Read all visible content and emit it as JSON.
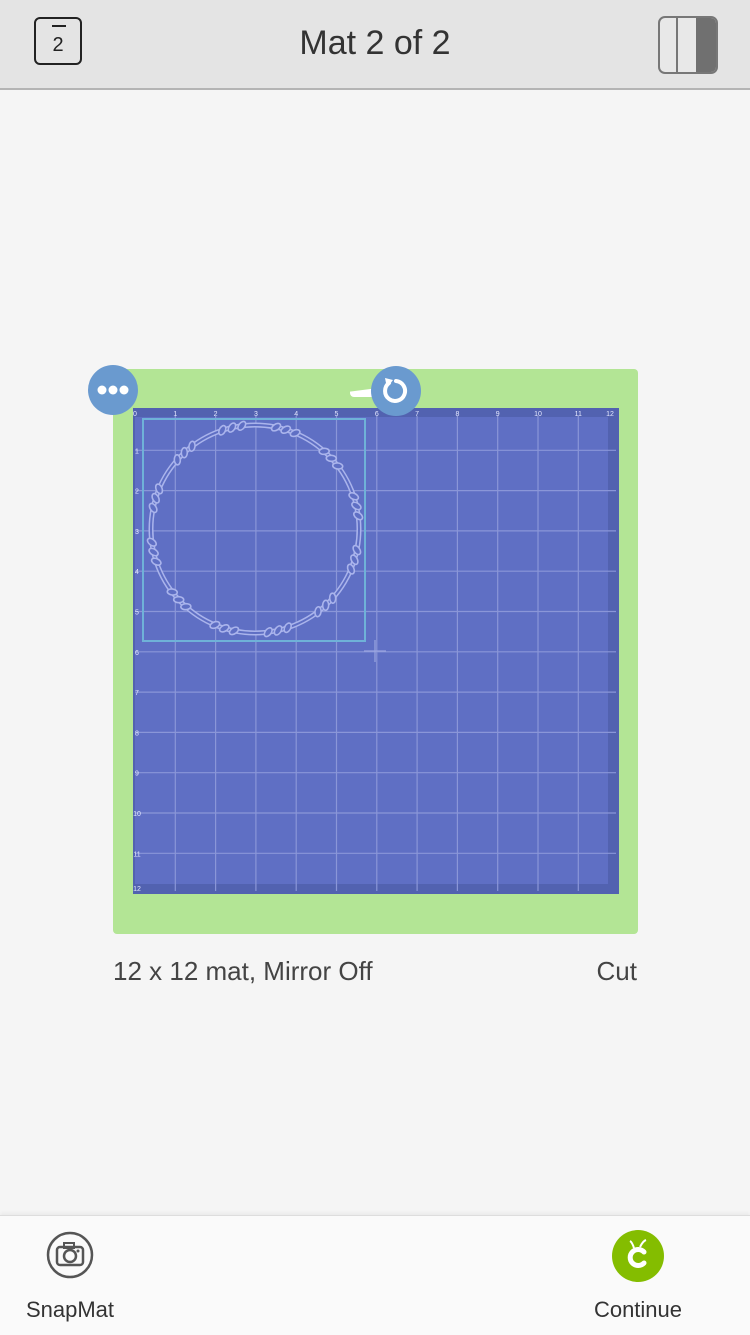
{
  "header": {
    "mat_number": "2",
    "title": "Mat 2 of 2",
    "panel_icon": "panel-toggle-icon"
  },
  "mat": {
    "background_color": "#b3e595",
    "surface_color": "#5f6fc4",
    "x_ticks": [
      "0",
      "1",
      "2",
      "3",
      "4",
      "5",
      "6",
      "7",
      "8",
      "9",
      "10",
      "11",
      "12"
    ],
    "y_ticks": [
      "1",
      "2",
      "3",
      "4",
      "5",
      "6",
      "7",
      "8",
      "9",
      "10",
      "11",
      "12"
    ],
    "design": "wreath",
    "more_icon": "more-horizontal-icon",
    "rotate_icon": "rotate-icon"
  },
  "info": {
    "description": "12 x 12 mat, Mirror Off",
    "mode": "Cut"
  },
  "footer": {
    "snapmat_label": "SnapMat",
    "continue_label": "Continue",
    "accent_color": "#84bd00"
  }
}
